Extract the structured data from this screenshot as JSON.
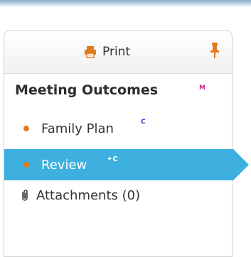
{
  "toolbar": {
    "print_label": "Print"
  },
  "sidebar": {
    "section_title": "Meeting Outcomes",
    "section_badge": "M",
    "items": [
      {
        "label": "Family Plan",
        "badge": "C",
        "active": false
      },
      {
        "label": "Review",
        "badge": "✦C",
        "active": true
      },
      {
        "label": "Attachments (0)",
        "icon": "paperclip-icon",
        "active": false
      }
    ]
  },
  "colors": {
    "accent": "#3db0df",
    "bullet": "#e07a1a",
    "print_icon": "#e07a1a",
    "pin_icon": "#e07a1a",
    "badge_m": "#c1289b",
    "badge_c": "#2d3fd4"
  }
}
